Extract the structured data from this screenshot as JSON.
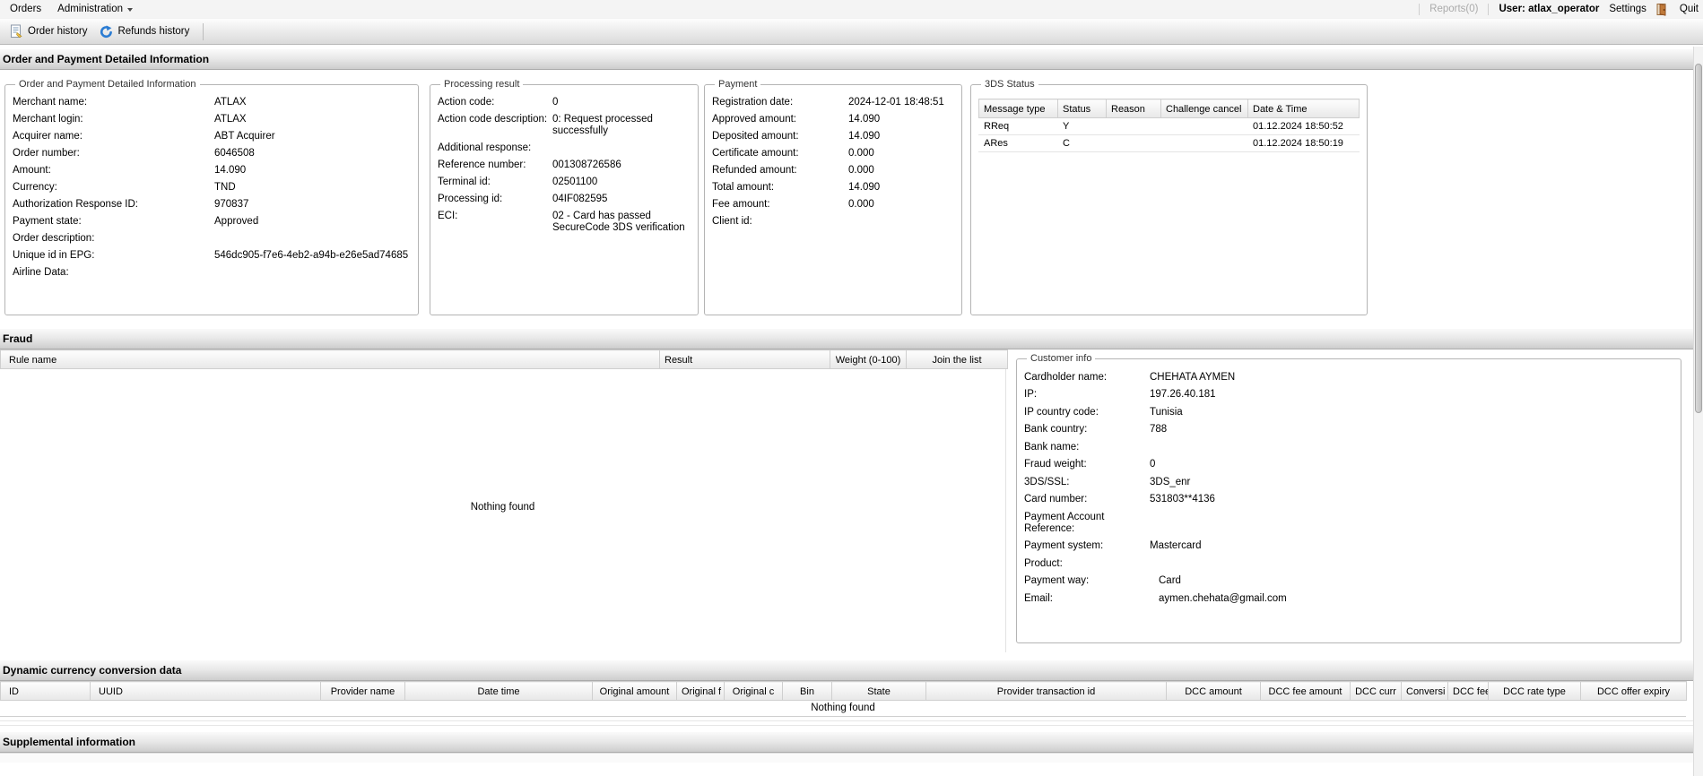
{
  "menubar": {
    "items": [
      {
        "label": "Orders"
      },
      {
        "label": "Administration"
      }
    ],
    "reports": "Reports(0)",
    "user": "User: atlax_operator",
    "settings": "Settings",
    "quit": "Quit"
  },
  "toolbar": {
    "order_history": "Order history",
    "refunds_history": "Refunds history"
  },
  "order_payment": {
    "title": "Order and Payment Detailed Information",
    "details": {
      "legend": "Order and Payment Detailed Information",
      "fields": [
        {
          "label": "Merchant name:",
          "value": "ATLAX"
        },
        {
          "label": "Merchant login:",
          "value": "ATLAX"
        },
        {
          "label": "Acquirer name:",
          "value": "ABT Acquirer"
        },
        {
          "label": "Order number:",
          "value": "6046508"
        },
        {
          "label": "Amount:",
          "value": "14.090"
        },
        {
          "label": "Currency:",
          "value": "TND"
        },
        {
          "label": "Authorization Response ID:",
          "value": "970837"
        },
        {
          "label": "Payment state:",
          "value": "Approved"
        },
        {
          "label": "Order description:",
          "value": ""
        },
        {
          "label": "Unique id in EPG:",
          "value": "546dc905-f7e6-4eb2-a94b-e26e5ad74685"
        },
        {
          "label": "Airline Data:",
          "value": ""
        }
      ]
    },
    "processing": {
      "legend": "Processing result",
      "fields": [
        {
          "label": "Action code:",
          "value": "0"
        },
        {
          "label": "Action code description:",
          "value": "0: Request processed successfully"
        },
        {
          "label": "Additional response:",
          "value": ""
        },
        {
          "label": "Reference number:",
          "value": "001308726586"
        },
        {
          "label": "Terminal id:",
          "value": "02501100"
        },
        {
          "label": "Processing id:",
          "value": "04IF082595"
        },
        {
          "label": "ECI:",
          "value": "02 - Card has passed SecureCode 3DS verification"
        }
      ]
    },
    "payment": {
      "legend": "Payment",
      "fields": [
        {
          "label": "Registration date:",
          "value": "2024-12-01 18:48:51"
        },
        {
          "label": "Approved amount:",
          "value": "14.090"
        },
        {
          "label": "Deposited amount:",
          "value": "14.090"
        },
        {
          "label": "Certificate amount:",
          "value": "0.000"
        },
        {
          "label": "Refunded amount:",
          "value": "0.000"
        },
        {
          "label": "Total amount:",
          "value": "14.090"
        },
        {
          "label": "Fee amount:",
          "value": "0.000"
        },
        {
          "label": "Client id:",
          "value": ""
        }
      ]
    },
    "threeds": {
      "legend": "3DS Status",
      "headers": [
        "Message type",
        "Status",
        "Reason",
        "Challenge cancel",
        "Date & Time"
      ],
      "rows": [
        [
          "RReq",
          "Y",
          "",
          "",
          "01.12.2024 18:50:52"
        ],
        [
          "ARes",
          "C",
          "",
          "",
          "01.12.2024 18:50:19"
        ]
      ]
    }
  },
  "fraud": {
    "title": "Fraud",
    "headers": [
      "Rule name",
      "Result",
      "Weight (0-100)",
      "Join the list"
    ],
    "empty": "Nothing found",
    "customer": {
      "legend": "Customer info",
      "fields": [
        {
          "label": "Cardholder name:",
          "value": "CHEHATA AYMEN"
        },
        {
          "label": "IP:",
          "value": "197.26.40.181"
        },
        {
          "label": "IP country code:",
          "value": "Tunisia"
        },
        {
          "label": "Bank country:",
          "value": "788"
        },
        {
          "label": "Bank name:",
          "value": ""
        },
        {
          "label": "Fraud weight:",
          "value": "0"
        },
        {
          "label": "3DS/SSL:",
          "value": "3DS_enr"
        },
        {
          "label": "Card number:",
          "value": "531803**4136"
        },
        {
          "label": "Payment Account Reference:",
          "value": ""
        },
        {
          "label": "Payment system:",
          "value": "Mastercard"
        },
        {
          "label": "Product:",
          "value": ""
        },
        {
          "label": "Payment way:",
          "value": "Card"
        },
        {
          "label": "Email:",
          "value": "aymen.chehata@gmail.com"
        }
      ]
    }
  },
  "dcc": {
    "title": "Dynamic currency conversion data",
    "headers": [
      "ID",
      "UUID",
      "Provider name",
      "Date time",
      "Original amount",
      "Original f",
      "Original c",
      "Bin",
      "State",
      "Provider transaction id",
      "DCC amount",
      "DCC fee amount",
      "DCC curr",
      "Conversi",
      "DCC fee",
      "DCC rate type",
      "DCC offer expiry"
    ],
    "empty": "Nothing found"
  },
  "supplemental": {
    "title": "Supplemental information"
  },
  "colors": {
    "accent_blue": "#2b7cd3",
    "door_brown": "#c07a3a",
    "header_gray": "#cdcdcd"
  },
  "icons": {
    "order_history": "document-page",
    "refunds_history": "blue-circular-arrow",
    "administration": "dropdown-caret",
    "quit": "exit-door"
  }
}
